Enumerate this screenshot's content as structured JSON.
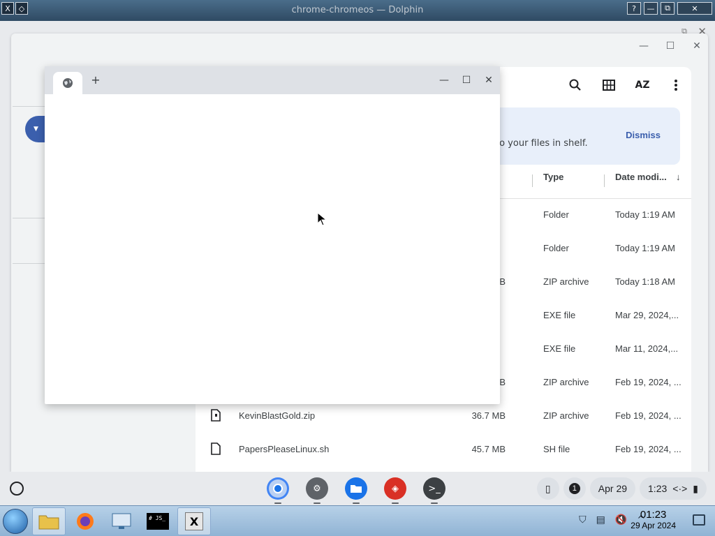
{
  "outer_window": {
    "title": "chrome-chromeos — Dolphin",
    "help_label": "?",
    "min_label": "—",
    "max_label": "⧉",
    "close_label": "✕"
  },
  "files_app": {
    "toolbar_icons": [
      "search-icon",
      "grid-view-icon",
      "sort-az-icon",
      "more-vert-icon"
    ],
    "sort_label": "AZ",
    "banner_text": "to your files in shelf.",
    "dismiss_label": "Dismiss",
    "columns": {
      "type": "Type",
      "date": "Date modi..."
    },
    "rows": [
      {
        "name": "",
        "size": "",
        "type": "Folder",
        "date": "Today 1:19 AM"
      },
      {
        "name": "",
        "size": "",
        "type": "Folder",
        "date": "Today 1:19 AM"
      },
      {
        "name": "",
        "size": "B",
        "type": "ZIP archive",
        "date": "Today 1:18 AM"
      },
      {
        "name": "",
        "size": "",
        "type": "EXE file",
        "date": "Mar 29, 2024,..."
      },
      {
        "name": "",
        "size": "",
        "type": "EXE file",
        "date": "Mar 11, 2024,..."
      },
      {
        "name": "",
        "size": "B",
        "type": "ZIP archive",
        "date": "Feb 19, 2024, ..."
      },
      {
        "name": "KevinBlastGold.zip",
        "size": "36.7 MB",
        "type": "ZIP archive",
        "date": "Feb 19, 2024, ..."
      },
      {
        "name": "PapersPleaseLinux.sh",
        "size": "45.7 MB",
        "type": "SH file",
        "date": "Feb 19, 2024, ..."
      }
    ]
  },
  "chrome_window": {
    "new_tab_label": "+",
    "min_label": "—",
    "max_label": "☐",
    "close_label": "✕"
  },
  "shelf": {
    "apps": [
      "chrome",
      "settings",
      "files",
      "gallery",
      "terminal"
    ],
    "notification_count": "1",
    "date": "Apr 29",
    "time": "1:23"
  },
  "taskbar": {
    "items": [
      "file-explorer",
      "firefox",
      "remote-desktop",
      "terminal",
      "x-server"
    ],
    "clock_time": "01:23",
    "clock_date": "29 Apr 2024",
    "terminal_text": "# JS_"
  }
}
